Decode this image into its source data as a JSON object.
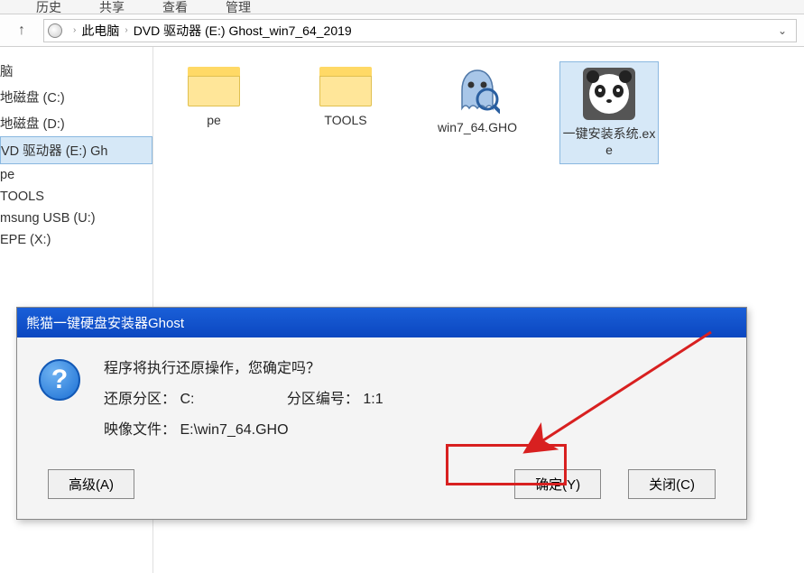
{
  "menu": {
    "history": "历史",
    "share": "共享",
    "view": "查看",
    "manage": "管理"
  },
  "address": {
    "seg1": "此电脑",
    "seg2": "DVD 驱动器 (E:) Ghost_win7_64_2019"
  },
  "sidebar": {
    "items": [
      "脑",
      "地磁盘 (C:)",
      "地磁盘 (D:)",
      "VD 驱动器 (E:) Gh",
      "pe",
      "TOOLS",
      "msung USB (U:)",
      "EPE (X:)"
    ],
    "selected_index": 3
  },
  "files": [
    {
      "type": "folder",
      "name": "pe"
    },
    {
      "type": "folder",
      "name": "TOOLS"
    },
    {
      "type": "gho",
      "name": "win7_64.GHO"
    },
    {
      "type": "exe",
      "name": "一键安装系统.exe",
      "selected": true
    }
  ],
  "dialog": {
    "title": "熊猫一键硬盘安装器Ghost",
    "message": "程序将执行还原操作，您确定吗？",
    "partition_label": "还原分区：",
    "partition_value": "C:",
    "partnum_label": "分区编号：",
    "partnum_value": "1:1",
    "image_label": "映像文件：",
    "image_value": "E:\\win7_64.GHO",
    "btn_advanced": "高级(A)",
    "btn_ok": "确定(Y)",
    "btn_close": "关闭(C)"
  }
}
